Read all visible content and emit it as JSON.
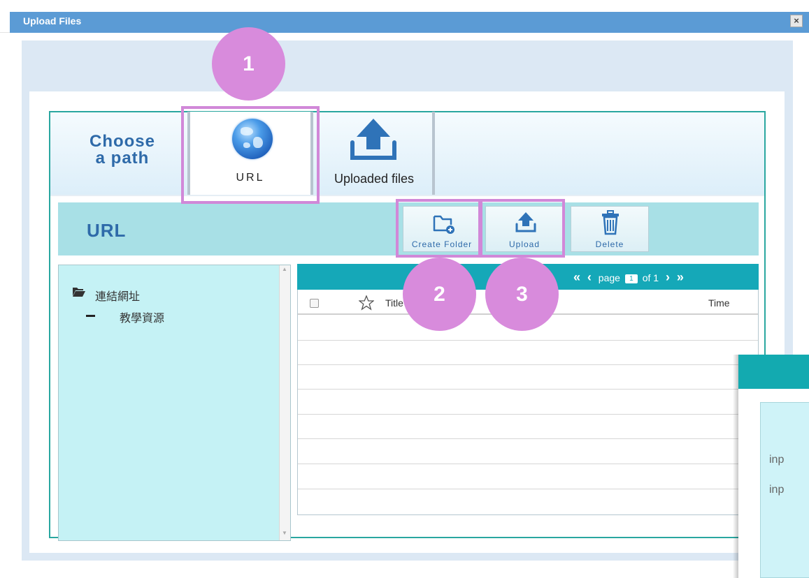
{
  "window": {
    "title": "Upload Files",
    "close_label": "×"
  },
  "path_chooser": {
    "heading": "Choose\na path",
    "tabs": [
      {
        "label": "URL",
        "icon": "globe-icon",
        "selected": true
      },
      {
        "label": "Uploaded files",
        "icon": "upload-arrow-icon",
        "selected": false
      }
    ]
  },
  "section": {
    "title": "URL"
  },
  "toolbar": {
    "create_folder": "Create Folder",
    "upload": "Upload",
    "delete": "Delete"
  },
  "tree": {
    "root": "連結網址",
    "children": [
      "教學資源"
    ]
  },
  "table": {
    "pager": {
      "prefix": "page",
      "current": "1",
      "suffix": "of 1"
    },
    "columns": {
      "title": "Title",
      "time": "Time"
    },
    "rows": []
  },
  "popup": {
    "lines": [
      "inp",
      "inp"
    ]
  },
  "callouts": [
    "1",
    "2",
    "3"
  ],
  "colors": {
    "titlebar": "#5b9bd5",
    "accent_teal": "#15a8b8",
    "callout": "#d88bdc",
    "heading_blue": "#2e6aa9"
  }
}
